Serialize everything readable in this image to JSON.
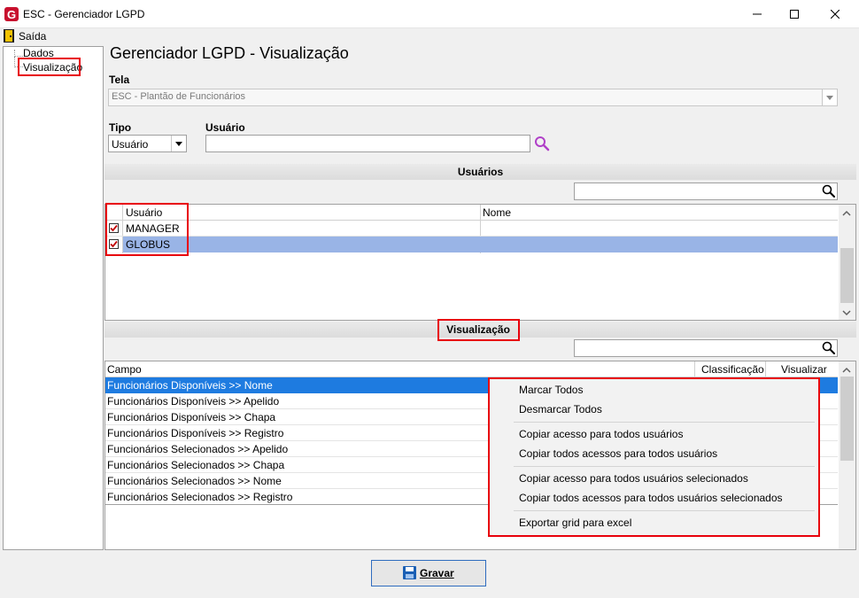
{
  "window": {
    "title": "ESC - Gerenciador LGPD"
  },
  "menu": {
    "exit_label": "Saída"
  },
  "tree": {
    "items": [
      "Dados",
      "Visualização"
    ]
  },
  "page": {
    "title": "Gerenciador LGPD - Visualização"
  },
  "screen": {
    "label": "Tela",
    "value": "ESC - Plantão de Funcionários"
  },
  "type": {
    "label": "Tipo",
    "value": "Usuário"
  },
  "user": {
    "label": "Usuário",
    "value": ""
  },
  "users_section": {
    "title": "Usuários",
    "search_value": "",
    "columns": [
      "Usuário",
      "Nome"
    ],
    "rows": [
      {
        "user": "MANAGER",
        "name": "",
        "checked": true,
        "selected": false
      },
      {
        "user": "GLOBUS",
        "name": "",
        "checked": true,
        "selected": true
      }
    ]
  },
  "view_section": {
    "title": "Visualização",
    "search_value": "",
    "columns": [
      "Campo",
      "Classificação",
      "Visualizar"
    ],
    "rows": [
      "Funcionários Disponíveis >> Nome",
      "Funcionários Disponíveis >> Apelido",
      "Funcionários Disponíveis >> Chapa",
      "Funcionários Disponíveis >> Registro",
      "Funcionários Selecionados >> Apelido",
      "Funcionários Selecionados >> Chapa",
      "Funcionários Selecionados >> Nome",
      "Funcionários Selecionados >> Registro"
    ],
    "selected_row": 0
  },
  "context_menu": {
    "items": [
      "Marcar Todos",
      "Desmarcar Todos",
      "Copiar acesso para todos usuários",
      "Copiar todos acessos para todos usuários",
      "Copiar acesso para todos usuários selecionados",
      "Copiar todos acessos para todos usuários selecionados",
      "Exportar grid para excel"
    ]
  },
  "buttons": {
    "save": "Gravar"
  },
  "colors": {
    "highlight_red": "#e8000b",
    "selected_row": "#99b4e6",
    "selected_blue": "#1e7be0",
    "search_icon_purple": "#b040c8"
  },
  "icons": [
    "app-logo-icon",
    "minimize-icon",
    "maximize-icon",
    "close-icon",
    "exit-door-icon",
    "search-icon",
    "checkbox-icon",
    "scroll-up-icon",
    "scroll-down-icon",
    "save-disk-icon",
    "dropdown-arrow-icon"
  ]
}
